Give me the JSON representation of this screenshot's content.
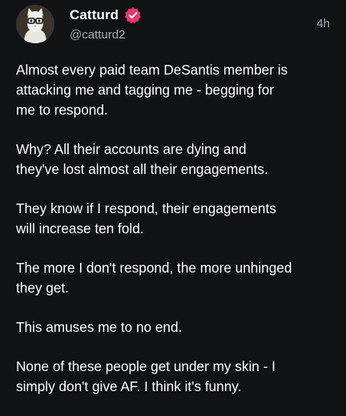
{
  "post": {
    "author": {
      "display_name": "Catturd",
      "handle": "@catturd2",
      "verified": true,
      "avatar_icon": "cat-with-glasses-avatar"
    },
    "time": "4h",
    "paragraphs": [
      "Almost every paid team DeSantis member is\nattacking me and tagging me - begging for\nme to respond.",
      "Why? All their accounts are dying and\nthey've lost almost all their engagements.",
      "They know if I respond, their engagements\nwill increase ten fold.",
      "The more I don't respond, the more unhinged\nthey get.",
      "This amuses me to no end.",
      "None of these people get under my skin - I\nsimply don't give AF. I think it's funny."
    ]
  },
  "colors": {
    "background": "#101214",
    "text": "#ffffff",
    "muted": "#a7adb5",
    "verified_badge": "#e8376f"
  }
}
